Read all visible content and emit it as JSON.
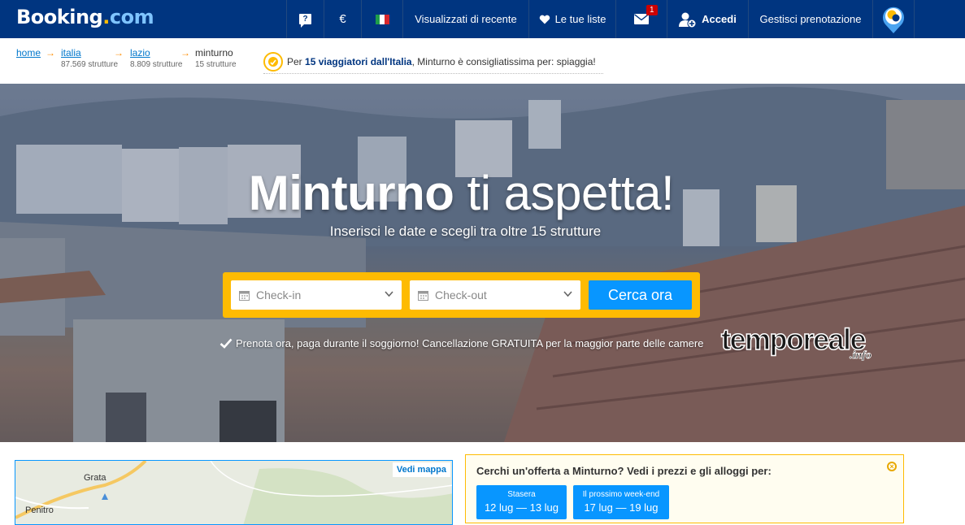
{
  "header": {
    "logo_main": "Booking",
    "logo_dot": ".",
    "logo_com": "com",
    "help_glyph": "?",
    "currency": "€",
    "recent": "Visualizzati di recente",
    "lists": "Le tue liste",
    "messages_badge": "1",
    "login": "Accedi",
    "manage": "Gestisci prenotazione",
    "icons": [
      "help-icon",
      "italy-flag-icon",
      "heart-icon",
      "envelope-icon",
      "user-add-icon",
      "chat-pin-icon"
    ]
  },
  "breadcrumb": [
    {
      "name": "home",
      "count": "87.569 strutture"
    },
    {
      "name": "italia",
      "count": "87.569 strutture"
    },
    {
      "name": "lazio",
      "count": "8.809 strutture"
    },
    {
      "name": "minturno",
      "count": "15 strutture"
    }
  ],
  "promo": {
    "prefix": "Per ",
    "highlight": "15 viaggiatori dall'Italia",
    "suffix": ", Minturno è consigliatissima per: spiaggia!"
  },
  "hero": {
    "title_bold": "Minturno",
    "title_rest": " ti aspetta!",
    "subtitle": "Inserisci le date e scegli tra oltre 15 strutture",
    "checkin_placeholder": "Check-in",
    "checkout_placeholder": "Check-out",
    "search_button": "Cerca ora",
    "guarantee": "Prenota ora, paga durante il soggiorno! Cancellazione GRATUITA per la maggior parte delle camere",
    "watermark": "temporeale",
    "watermark_suffix": ".info"
  },
  "map": {
    "link": "Vedi mappa",
    "labels": [
      "Grata",
      "Penitro"
    ]
  },
  "offer": {
    "title": "Cerchi un'offerta a Minturno? Vedi i prezzi e gli alloggi per:",
    "deals": [
      {
        "label": "Stasera",
        "range": "12 lug — 13 lug"
      },
      {
        "label": "Il prossimo week-end",
        "range": "17 lug — 19 lug"
      }
    ]
  },
  "colors": {
    "brand_blue": "#003580",
    "accent_yellow": "#febb02",
    "button_blue": "#0896ff",
    "link_blue": "#0077cc"
  }
}
